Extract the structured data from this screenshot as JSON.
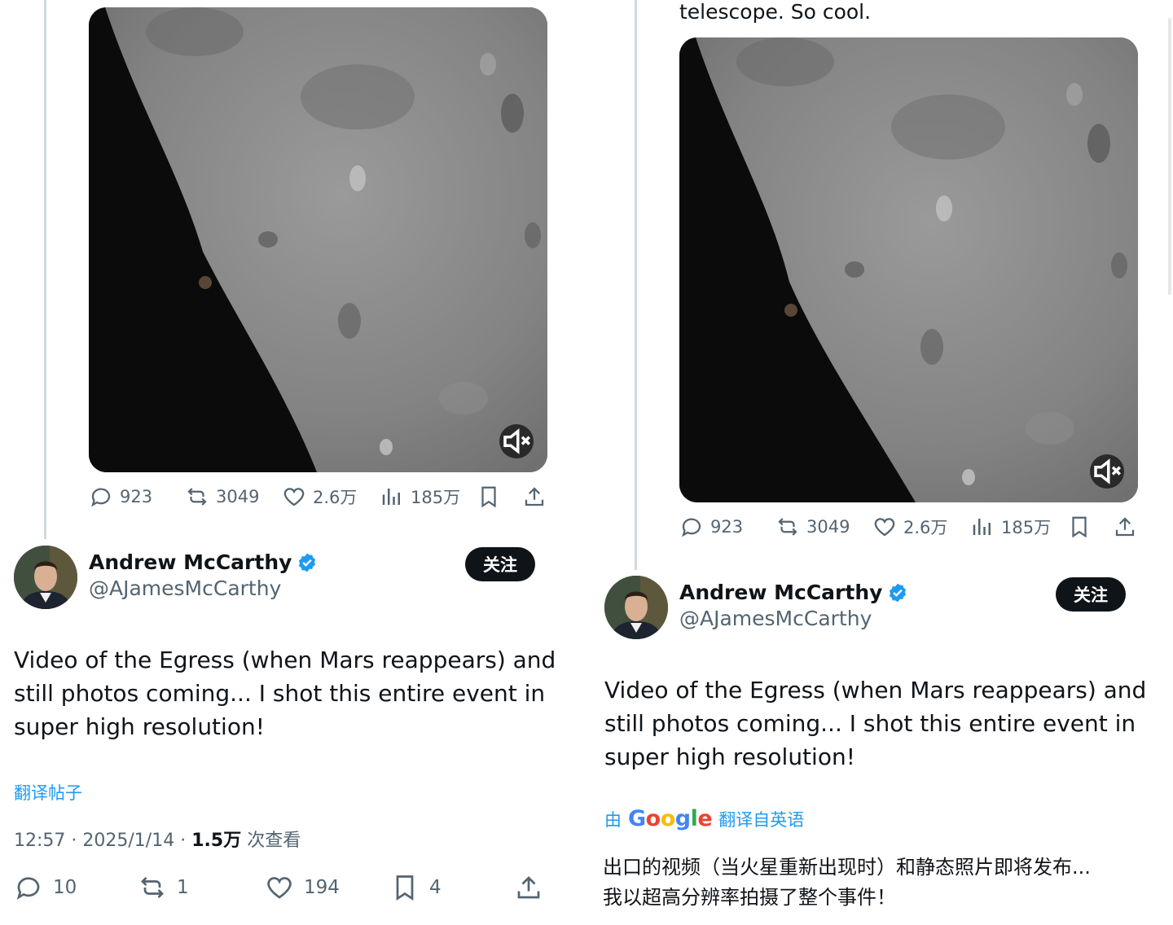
{
  "left": {
    "stats": {
      "replies": "923",
      "reposts": "3049",
      "likes": "2.6万",
      "views": "185万"
    },
    "author": {
      "name": "Andrew McCarthy",
      "handle": "@AJamesMcCarthy",
      "follow_label": "关注"
    },
    "tweet_text": "Video of the Egress (when Mars reappears) and\nstill photos coming... I shot this entire event in\nsuper high resolution!",
    "translate_link": "翻译帖子",
    "meta": {
      "time": "12:57",
      "date": "2025/1/14",
      "views_count": "1.5万",
      "views_label": "次查看"
    },
    "bottom": {
      "replies": "10",
      "reposts": "1",
      "likes": "194",
      "bookmarks": "4"
    }
  },
  "right": {
    "previous_text_tail": "telescope. So cool.",
    "stats": {
      "replies": "923",
      "reposts": "3049",
      "likes": "2.6万",
      "views": "185万"
    },
    "author": {
      "name": "Andrew McCarthy",
      "handle": "@AJamesMcCarthy",
      "follow_label": "关注"
    },
    "tweet_text": "Video of the Egress (when Mars reappears) and\nstill photos coming... I shot this entire event in\nsuper high resolution!",
    "translation": {
      "prefix": "由",
      "provider": "Google",
      "suffix": "翻译自英语",
      "text": "出口的视频（当火星重新出现时）和静态照片即将发布...\n我以超高分辨率拍摄了整个事件！"
    }
  },
  "colors": {
    "accent": "#1d9bf0",
    "text": "#0f1419",
    "muted": "#536471",
    "verified": "#1d9bf0"
  }
}
